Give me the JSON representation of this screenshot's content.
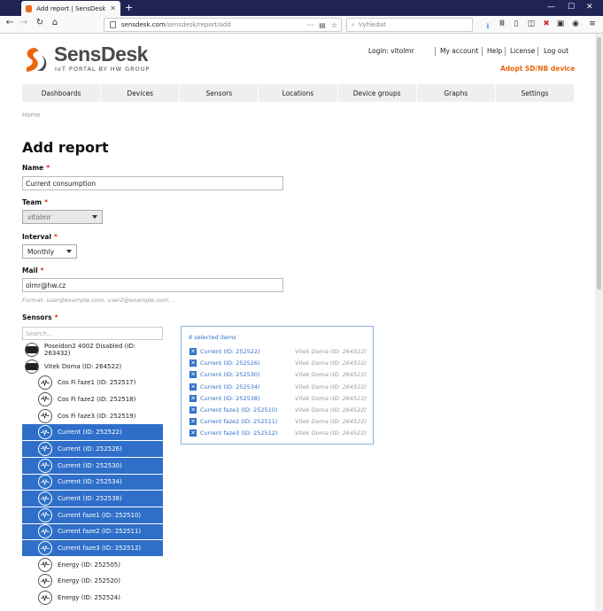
{
  "browser": {
    "tab_title": "Add report | SensDesk",
    "url_domain": "sensdesk.com",
    "url_path": "/sensdesk/report/add",
    "search_placeholder": "Vyhledat"
  },
  "header": {
    "logo_name": "SensDesk",
    "logo_tagline": "IoT PORTAL BY HW GROUP",
    "login_label": "Login: vitolmr",
    "my_account": "My account",
    "help": "Help",
    "license": "License",
    "logout": "Log out",
    "adopt": "Adopt SD/NB device",
    "brand_color": "#e8650c"
  },
  "menu": [
    "Dashboards",
    "Devices",
    "Sensors",
    "Locations",
    "Device groups",
    "Graphs",
    "Settings"
  ],
  "breadcrumb": "Home",
  "page_title": "Add report",
  "form": {
    "name_label": "Name",
    "name_value": "Current consumption",
    "team_label": "Team",
    "team_value": "vitolmr",
    "interval_label": "Interval",
    "interval_value": "Monthly",
    "mail_label": "Mail",
    "mail_value": "olmr@hw.cz",
    "mail_hint": "Format: user@example.com, user2@example.com, ...",
    "sensors_label": "Sensors",
    "required_mark": "*"
  },
  "sensors": {
    "search_placeholder": "Search...",
    "tree": [
      {
        "label": "Poseidon2 4002 Disabled (ID: 263432)",
        "kind": "device",
        "selected": false
      },
      {
        "label": "Vitek Doma (ID: 264522)",
        "kind": "device",
        "selected": false
      },
      {
        "label": "Cos Fi faze1 (ID: 252517)",
        "kind": "sensor",
        "selected": false
      },
      {
        "label": "Cos Fi faze2 (ID: 252518)",
        "kind": "sensor",
        "selected": false
      },
      {
        "label": "Cos Fi faze3 (ID: 252519)",
        "kind": "sensor",
        "selected": false
      },
      {
        "label": "Current (ID: 252522)",
        "kind": "sensor",
        "selected": true
      },
      {
        "label": "Current (ID: 252526)",
        "kind": "sensor",
        "selected": true
      },
      {
        "label": "Current (ID: 252530)",
        "kind": "sensor",
        "selected": true
      },
      {
        "label": "Current (ID: 252534)",
        "kind": "sensor",
        "selected": true
      },
      {
        "label": "Current (ID: 252538)",
        "kind": "sensor",
        "selected": true
      },
      {
        "label": "Current faze1 (ID: 252510)",
        "kind": "sensor",
        "selected": true
      },
      {
        "label": "Current faze2 (ID: 252511)",
        "kind": "sensor",
        "selected": true
      },
      {
        "label": "Current faze3 (ID: 252512)",
        "kind": "sensor",
        "selected": true
      },
      {
        "label": "Energy (ID: 252505)",
        "kind": "sensor",
        "selected": false
      },
      {
        "label": "Energy (ID: 252520)",
        "kind": "sensor",
        "selected": false
      },
      {
        "label": "Energy (ID: 252524)",
        "kind": "sensor",
        "selected": false
      }
    ],
    "selected_count_label": "8 selected items",
    "selected": [
      {
        "name": "Current (ID: 252522)",
        "device": "Vitek Doma (ID: 264522)"
      },
      {
        "name": "Current (ID: 252526)",
        "device": "Vitek Doma (ID: 264522)"
      },
      {
        "name": "Current (ID: 252530)",
        "device": "Vitek Doma (ID: 264522)"
      },
      {
        "name": "Current (ID: 252534)",
        "device": "Vitek Doma (ID: 264522)"
      },
      {
        "name": "Current (ID: 252538)",
        "device": "Vitek Doma (ID: 264522)"
      },
      {
        "name": "Current faze1 (ID: 252510)",
        "device": "Vitek Doma (ID: 264522)"
      },
      {
        "name": "Current faze2 (ID: 252511)",
        "device": "Vitek Doma (ID: 264522)"
      },
      {
        "name": "Current faze3 (ID: 252512)",
        "device": "Vitek Doma (ID: 264522)"
      }
    ],
    "selected_color": "#2f6fc9"
  }
}
